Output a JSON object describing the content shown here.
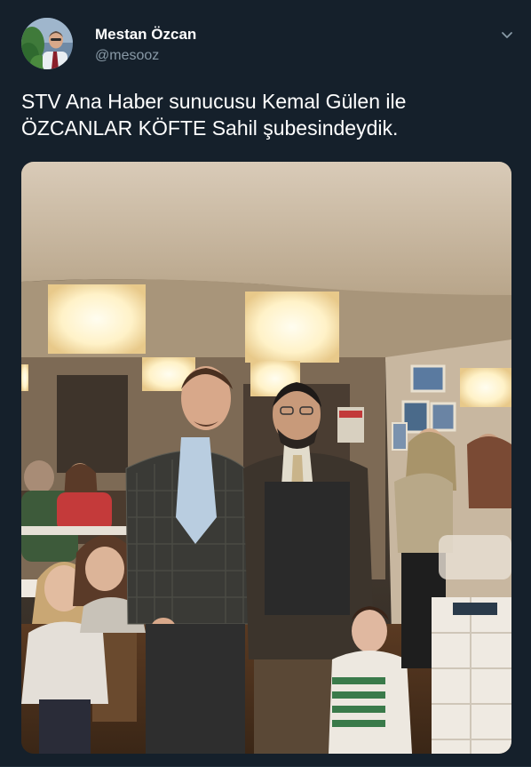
{
  "tweet": {
    "author": {
      "display_name": "Mestan Özcan",
      "handle": "@mesooz"
    },
    "text_line1": "STV Ana Haber sunucusu Kemal Gülen ile",
    "text_line2": "ÖZCANLAR KÖFTE Sahil şubesindeydik.",
    "menu_icon": "chevron-down-icon",
    "media": {
      "type": "photo"
    }
  },
  "colors": {
    "background": "#15202b",
    "text_primary": "#ffffff",
    "text_secondary": "#8899a6"
  }
}
